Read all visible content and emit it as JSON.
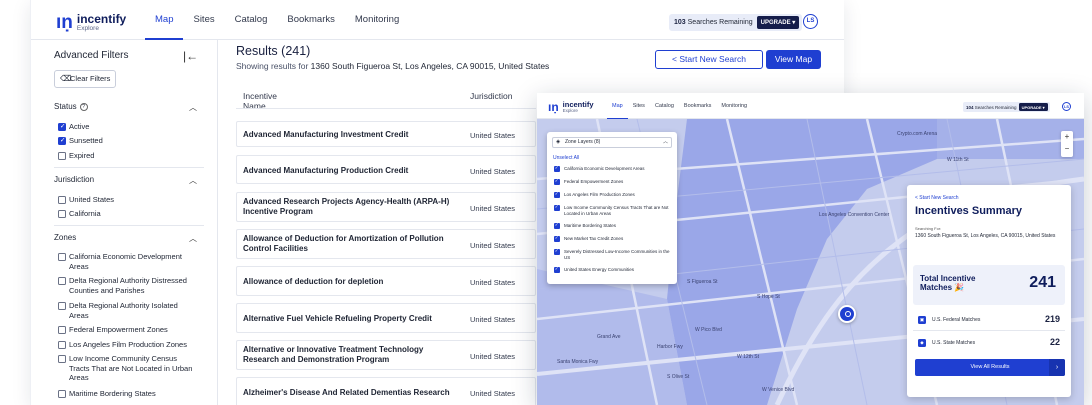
{
  "brand": {
    "name": "incentify",
    "sub": "Explore",
    "mark": "ıṇ"
  },
  "nav": {
    "tabs": [
      "Map",
      "Sites",
      "Catalog",
      "Bookmarks",
      "Monitoring"
    ],
    "searches_remaining": "103",
    "searches_label": "Searches Remaining",
    "upgrade": "UPGRADE ▾",
    "avatar": "LS"
  },
  "filters": {
    "title": "Advanced Filters",
    "collapse_icon": "|←",
    "clear_label": "Clear Filters",
    "status": {
      "label": "Status",
      "help": "?",
      "items": [
        {
          "label": "Active",
          "checked": true
        },
        {
          "label": "Sunsetted",
          "checked": true
        },
        {
          "label": "Expired",
          "checked": false
        }
      ]
    },
    "jurisdiction": {
      "label": "Jurisdiction",
      "items": [
        {
          "label": "United States",
          "checked": false
        },
        {
          "label": "California",
          "checked": false
        }
      ]
    },
    "zones": {
      "label": "Zones",
      "items": [
        {
          "label": "California Economic Development Areas",
          "checked": false
        },
        {
          "label": "Delta Regional Authority Distressed Counties and Parishes",
          "checked": false
        },
        {
          "label": "Delta Regional Authority Isolated Areas",
          "checked": false
        },
        {
          "label": "Federal Empowerment Zones",
          "checked": false
        },
        {
          "label": "Los Angeles Film Production Zones",
          "checked": false
        },
        {
          "label": "Low Income Community Census Tracts That are Not Located in Urban Areas",
          "checked": false
        },
        {
          "label": "Maritime Bordering States",
          "checked": false
        }
      ]
    }
  },
  "results": {
    "title": "Results (241)",
    "sub_prefix": "Showing results for",
    "address": "1360 South Figueroa St, Los Angeles, CA 90015, United States",
    "start_new": "< Start New Search",
    "view_map": "View Map",
    "col_name": "Incentive Name",
    "col_jur": "Jurisdiction",
    "rows": [
      {
        "name": "Advanced Manufacturing Investment Credit",
        "jur": "United States"
      },
      {
        "name": "Advanced Manufacturing Production Credit",
        "jur": "United States"
      },
      {
        "name": "Advanced Research Projects Agency-Health (ARPA-H) Incentive Program",
        "jur": "United States"
      },
      {
        "name": "Allowance of Deduction for Amortization of Pollution Control Facilities",
        "jur": "United States"
      },
      {
        "name": "Allowance of deduction for depletion",
        "jur": "United States"
      },
      {
        "name": "Alternative Fuel Vehicle Refueling Property Credit",
        "jur": "United States"
      },
      {
        "name": "Alternative or Innovative Treatment Technology Research and Demonstration Program",
        "jur": "United States"
      },
      {
        "name": "Alzheimer's Disease And Related Dementias Research",
        "jur": "United States"
      }
    ]
  },
  "map_view": {
    "searches_remaining": "104",
    "layers": {
      "header": "Zone Layers (8)",
      "unselect": "Unselect All",
      "items": [
        "California Economic Development Areas",
        "Federal Empowerment Zones",
        "Los Angeles Film Production Zones",
        "Low Income Community Census Tracts That are Not Located in Urban Areas",
        "Maritime Bordering States",
        "New Market Tax Credit Zones",
        "Severely Distressed Low-Income Communities in the US",
        "United States Energy Communities"
      ]
    },
    "zoom_in": "+",
    "zoom_out": "−",
    "labels": {
      "convention_center": "Los Angeles Convention Center",
      "crypto": "Crypto.com Arena",
      "figueroa": "S Figueroa St",
      "santa_monica": "Santa Monica Fwy",
      "w_pico": "W Pico Blvd",
      "w12": "W 12th St",
      "w11": "W 11th St",
      "s_olive": "S Olive St",
      "s_hope": "S Hope St",
      "grand": "Grand Ave",
      "venice": "W Venice Blvd",
      "harbor": "Harbor Fwy"
    },
    "summary": {
      "start_new": "< Start New Search",
      "title": "Incentives Summary",
      "searching_for": "Searching For:",
      "address": "1360 South Figueroa St, Los Angeles, CA 90015, United States",
      "total_label": "Total Incentive Matches 🎉",
      "total_value": "241",
      "federal_label": "U.S. Federal Matches",
      "federal_value": "219",
      "state_label": "U.S. State Matches",
      "state_value": "22",
      "view_all": "View All Results",
      "view_all_arrow": "›"
    }
  },
  "colors": {
    "accent": "#1f3fd1",
    "navy": "#0f1d5c",
    "map_zone": "#8c9be6",
    "map_bg": "#c4cced"
  }
}
